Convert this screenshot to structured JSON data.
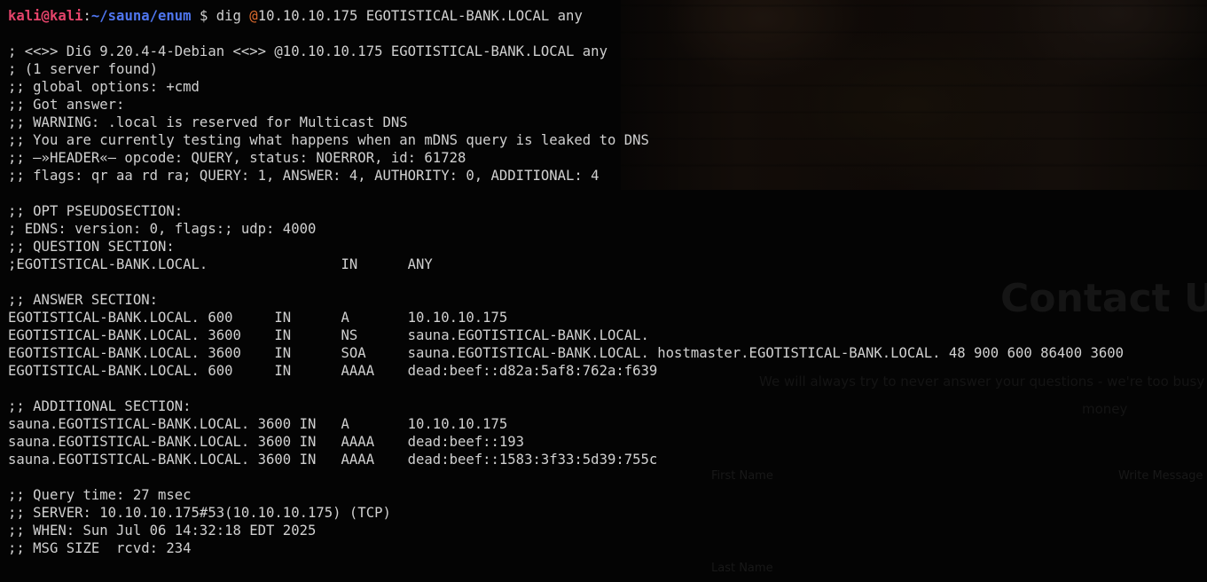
{
  "background_page": {
    "contact_title": "Contact Us",
    "contact_subtitle": "We will always try to never answer your questions - we're too busy",
    "contact_subtitle_2": "money",
    "first_name_label": "First Name",
    "write_message_label": "Write Message",
    "last_name_label": "Last Name"
  },
  "prompt": {
    "user_host": "kali@kali",
    "separator": ":",
    "path": "~/sauna/enum",
    "symbol": "$"
  },
  "command": {
    "name": "dig",
    "at": "@",
    "rest": "10.10.10.175 EGOTISTICAL-BANK.LOCAL any"
  },
  "output": [
    "; <<>> DiG 9.20.4-4-Debian <<>> @10.10.10.175 EGOTISTICAL-BANK.LOCAL any",
    "; (1 server found)",
    ";; global options: +cmd",
    ";; Got answer:",
    ";; WARNING: .local is reserved for Multicast DNS",
    ";; You are currently testing what happens when an mDNS query is leaked to DNS",
    ";; —»HEADER«— opcode: QUERY, status: NOERROR, id: 61728",
    ";; flags: qr aa rd ra; QUERY: 1, ANSWER: 4, AUTHORITY: 0, ADDITIONAL: 4",
    "",
    ";; OPT PSEUDOSECTION:",
    "; EDNS: version: 0, flags:; udp: 4000",
    ";; QUESTION SECTION:",
    ";EGOTISTICAL-BANK.LOCAL.                IN      ANY",
    "",
    ";; ANSWER SECTION:",
    "EGOTISTICAL-BANK.LOCAL. 600     IN      A       10.10.10.175",
    "EGOTISTICAL-BANK.LOCAL. 3600    IN      NS      sauna.EGOTISTICAL-BANK.LOCAL.",
    "EGOTISTICAL-BANK.LOCAL. 3600    IN      SOA     sauna.EGOTISTICAL-BANK.LOCAL. hostmaster.EGOTISTICAL-BANK.LOCAL. 48 900 600 86400 3600",
    "EGOTISTICAL-BANK.LOCAL. 600     IN      AAAA    dead:beef::d82a:5af8:762a:f639",
    "",
    ";; ADDITIONAL SECTION:",
    "sauna.EGOTISTICAL-BANK.LOCAL. 3600 IN   A       10.10.10.175",
    "sauna.EGOTISTICAL-BANK.LOCAL. 3600 IN   AAAA    dead:beef::193",
    "sauna.EGOTISTICAL-BANK.LOCAL. 3600 IN   AAAA    dead:beef::1583:3f33:5d39:755c",
    "",
    ";; Query time: 27 msec",
    ";; SERVER: 10.10.10.175#53(10.10.10.175) (TCP)",
    ";; WHEN: Sun Jul 06 14:32:18 EDT 2025",
    ";; MSG SIZE  rcvd: 234"
  ]
}
